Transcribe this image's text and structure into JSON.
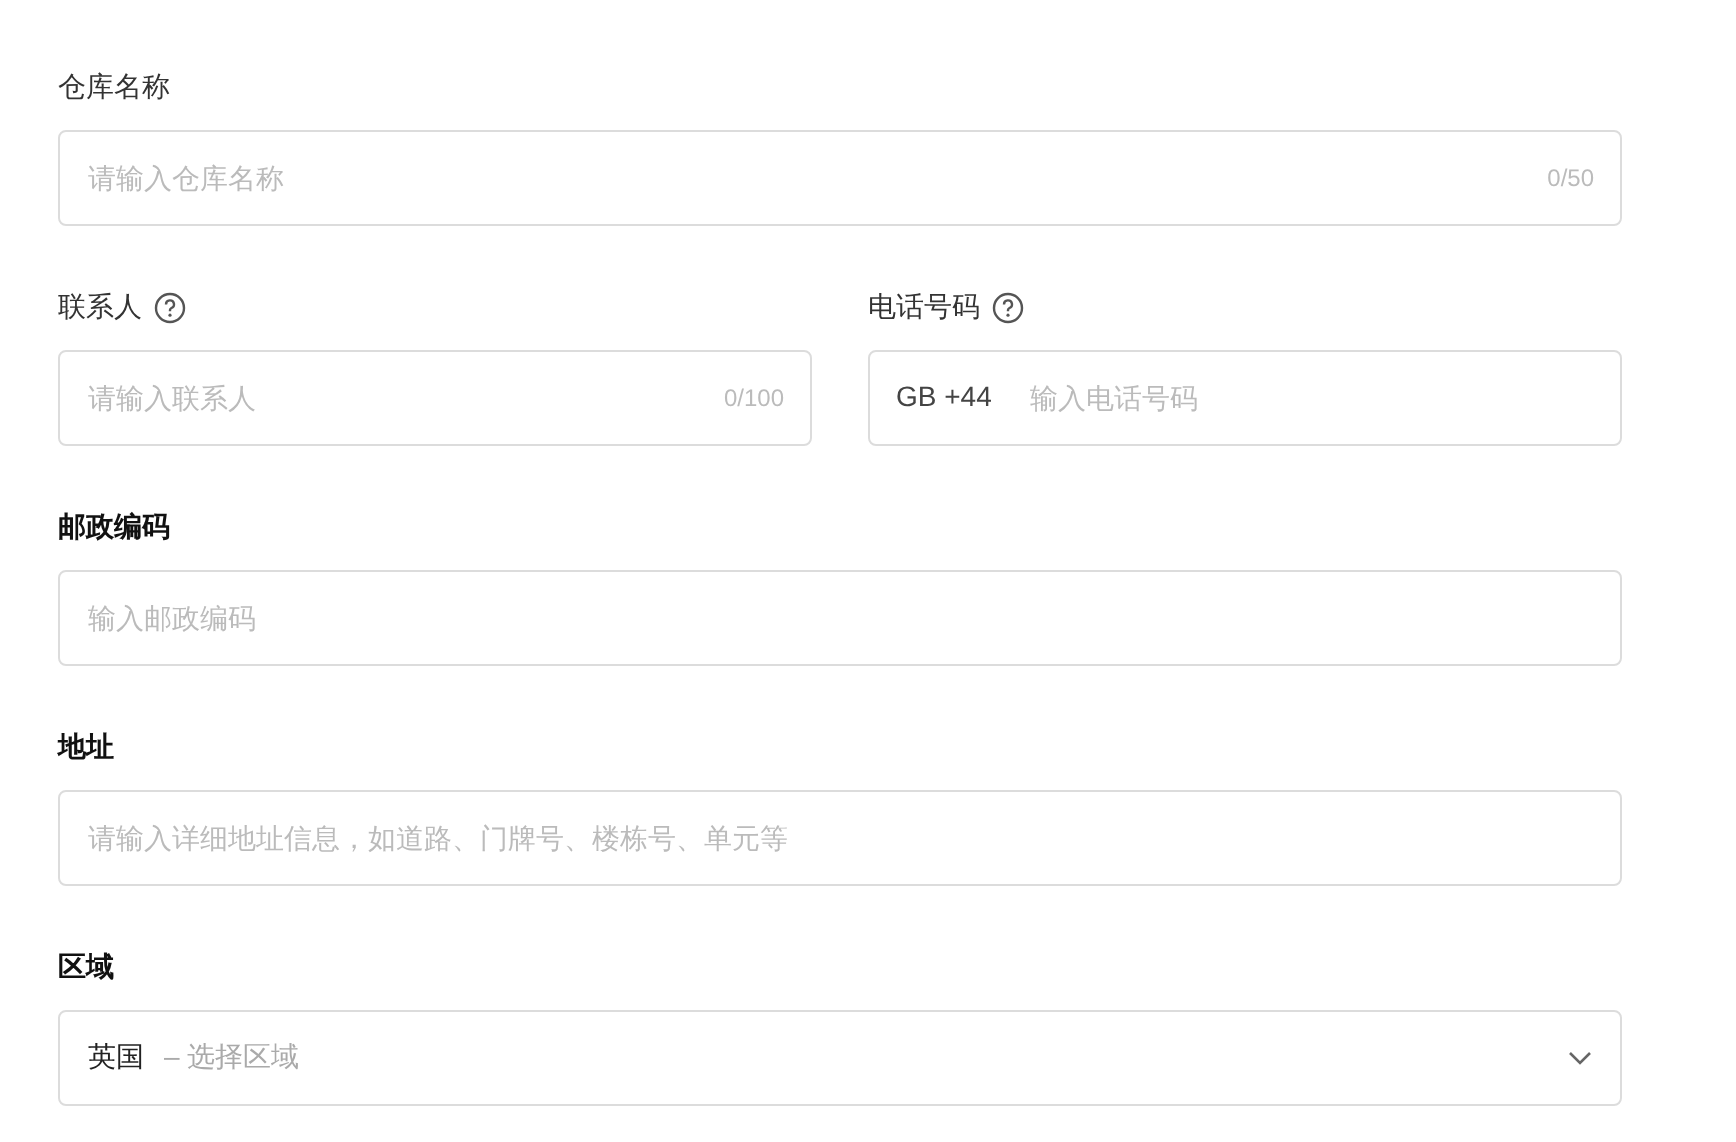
{
  "rows": [
    {
      "fields": [
        {
          "kind": "text",
          "label": "仓库名称",
          "bold": false,
          "help": false,
          "placeholder": "请输入仓库名称",
          "counter": "0/50"
        }
      ]
    },
    {
      "fields": [
        {
          "kind": "text",
          "label": "联系人",
          "bold": false,
          "help": true,
          "placeholder": "请输入联系人",
          "counter": "0/100"
        },
        {
          "kind": "phone",
          "label": "电话号码",
          "bold": false,
          "help": true,
          "prefix": "GB +44",
          "placeholder": "输入电话号码"
        }
      ]
    },
    {
      "fields": [
        {
          "kind": "text",
          "label": "邮政编码",
          "bold": true,
          "help": false,
          "placeholder": "输入邮政编码"
        }
      ]
    },
    {
      "fields": [
        {
          "kind": "text",
          "label": "地址",
          "bold": true,
          "help": false,
          "placeholder": "请输入详细地址信息，如道路、门牌号、楼栋号、单元等"
        }
      ]
    },
    {
      "fields": [
        {
          "kind": "select",
          "label": "区域",
          "bold": true,
          "help": false,
          "value": "英国",
          "placeholder": "– 选择区域"
        }
      ]
    }
  ]
}
